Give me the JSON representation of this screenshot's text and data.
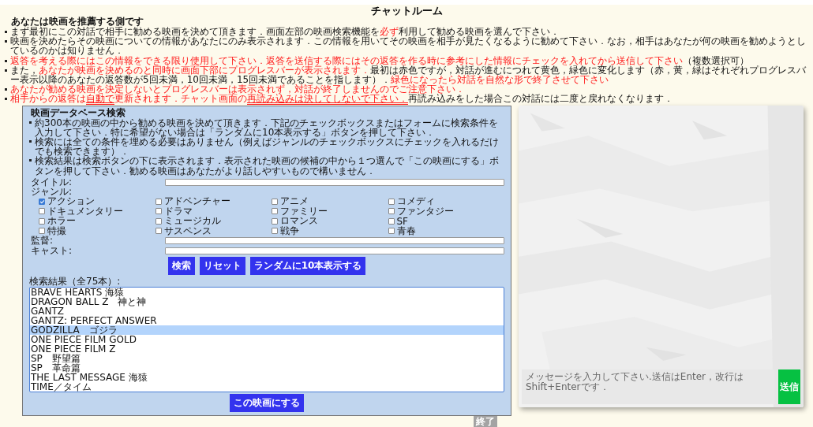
{
  "title": "チャットルーム",
  "role_heading": "あなたは映画を推薦する側です",
  "instructions": [
    {
      "segments": [
        {
          "text": "まず最初にこの対話で相手に勧める映画を決めて頂きます．画面左部の映画検索機能を",
          "red": false,
          "underline": false
        },
        {
          "text": "必ず",
          "red": true,
          "underline": false
        },
        {
          "text": "利用して勧める映画を選んで下さい．",
          "red": false,
          "underline": false
        }
      ]
    },
    {
      "segments": [
        {
          "text": "映画を決めたらその映画についての情報があなたにのみ表示されます．この情報を用いてその映画を相手が見たくなるように勧めて下さい．なお，相手はあなたが何の映画を勧めようとしているのかは知りません．",
          "red": false,
          "underline": false
        }
      ]
    },
    {
      "segments": [
        {
          "text": "返答を考える際にはこの情報をできる限り使用して下さい．返答を送信する際にはその返答を作る時に参考にした情報にチェックを入れてから送信して下さい",
          "red": true,
          "underline": false
        },
        {
          "text": "（複数選択可）",
          "red": false,
          "underline": false
        }
      ]
    },
    {
      "segments": [
        {
          "text": "また，",
          "red": false,
          "underline": false
        },
        {
          "text": "あなたが映画を決めるのと同時に画面下部にプログレスバーが表示されます．",
          "red": true,
          "underline": false
        },
        {
          "text": "最初は赤色ですが，対話が進むにつれて黄色，緑色に変化します（赤，黄，緑はそれぞれプログレスバー表示以降のあなたの返答数が5回未満，10回未満，15回未満であることを指します）．",
          "red": false,
          "underline": false
        },
        {
          "text": "緑色になったら対話を自然な形で終了させて下さい",
          "red": true,
          "underline": false
        }
      ]
    },
    {
      "segments": [
        {
          "text": "あなたが勧める映画を決定しないとプログレスバーは表示されず，対話が終了しませんのでご注意下さい．",
          "red": true,
          "underline": false
        }
      ]
    },
    {
      "segments": [
        {
          "text": "相手からの返答は",
          "red": true,
          "underline": false
        },
        {
          "text": "自動で",
          "red": true,
          "underline": true
        },
        {
          "text": "更新されます．チャット画面の",
          "red": true,
          "underline": false
        },
        {
          "text": "再読み込みは決してしないで下さい．",
          "red": true,
          "underline": true
        },
        {
          "text": "再読み込みをした場合この対話には二度と戻れなくなります．",
          "red": false,
          "underline": false
        }
      ]
    }
  ],
  "search_panel": {
    "heading": "映画データベース検索",
    "notes": [
      "約300本の映画の中から勧める映画を決めて頂きます．下記のチェックボックスまたはフォームに検索条件を入力して下さい．特に希望がない場合は「ランダムに10本表示する」ボタンを押して下さい．",
      "検索には全ての条件を埋める必要はありません（例えばジャンルのチェックボックスにチェックを入れるだけでも検索できます）．",
      "検索結果は検索ボタンの下に表示されます．表示された映画の候補の中から１つ選んで「この映画にする」ボタンを押して下さい．勧める映画はあなたがより話しやすいもので構いません．"
    ],
    "title_label": "タイトル:",
    "genre_label": "ジャンル:",
    "genres": [
      {
        "label": "アクション",
        "checked": true
      },
      {
        "label": "アドベンチャー",
        "checked": false
      },
      {
        "label": "アニメ",
        "checked": false
      },
      {
        "label": "コメディ",
        "checked": false
      },
      {
        "label": "ドキュメンタリー",
        "checked": false
      },
      {
        "label": "ドラマ",
        "checked": false
      },
      {
        "label": "ファミリー",
        "checked": false
      },
      {
        "label": "ファンタジー",
        "checked": false
      },
      {
        "label": "ホラー",
        "checked": false
      },
      {
        "label": "ミュージカル",
        "checked": false
      },
      {
        "label": "ロマンス",
        "checked": false
      },
      {
        "label": "SF",
        "checked": false
      },
      {
        "label": "特撮",
        "checked": false
      },
      {
        "label": "サスペンス",
        "checked": false
      },
      {
        "label": "戦争",
        "checked": false
      },
      {
        "label": "青春",
        "checked": false
      }
    ],
    "director_label": "監督:",
    "cast_label": "キャスト:",
    "buttons": [
      "検索",
      "リセット",
      "ランダムに10本表示する"
    ],
    "results_label": "検索結果（全75本）:",
    "results": [
      {
        "title": "BRAVE HEARTS 海猿",
        "selected": false
      },
      {
        "title": "DRAGON BALL Z　神と神",
        "selected": false
      },
      {
        "title": "GANTZ",
        "selected": false
      },
      {
        "title": "GANTZ: PERFECT ANSWER",
        "selected": false
      },
      {
        "title": "GODZILLA　ゴジラ",
        "selected": true
      },
      {
        "title": "ONE PIECE FILM GOLD",
        "selected": false
      },
      {
        "title": "ONE PIECE FILM Z",
        "selected": false
      },
      {
        "title": "SP　野望篇",
        "selected": false
      },
      {
        "title": "SP　革命篇",
        "selected": false
      },
      {
        "title": "THE LAST MESSAGE 海猿",
        "selected": false
      },
      {
        "title": "TIME／タイム",
        "selected": false
      }
    ],
    "choose_button": "この映画にする"
  },
  "chat": {
    "placeholder": "メッセージを入力して下さい.送信はEnter，改行はShift+Enterです．",
    "send_button": "送信"
  },
  "end_button": "終了"
}
